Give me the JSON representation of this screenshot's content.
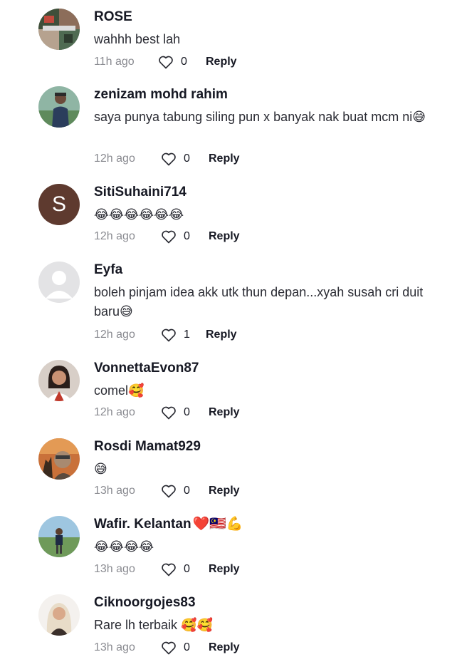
{
  "comments": [
    {
      "username": "ROSE",
      "username_emoji": "",
      "text": "wahhh best lah",
      "time": "11h ago",
      "likes": "0",
      "reply_label": "Reply"
    },
    {
      "username": "zenizam mohd rahim",
      "username_emoji": "",
      "text": "saya punya tabung siling pun x banyak nak buat mcm ni😅",
      "time": "12h ago",
      "likes": "0",
      "reply_label": "Reply"
    },
    {
      "username": "SitiSuhaini714",
      "username_emoji": "",
      "text": "😂😂😂😂😂😂",
      "time": "12h ago",
      "likes": "0",
      "reply_label": "Reply",
      "avatar_letter": "S"
    },
    {
      "username": "Eyfa",
      "username_emoji": "",
      "text": "boleh pinjam idea akk utk thun depan...xyah susah cri duit baru😅",
      "time": "12h ago",
      "likes": "1",
      "reply_label": "Reply"
    },
    {
      "username": "VonnettaEvon87",
      "username_emoji": "",
      "text": "comel🥰",
      "time": "12h ago",
      "likes": "0",
      "reply_label": "Reply"
    },
    {
      "username": "Rosdi Mamat929",
      "username_emoji": "",
      "text": "😅",
      "time": "13h ago",
      "likes": "0",
      "reply_label": "Reply"
    },
    {
      "username": "Wafir. Kelantan",
      "username_emoji": "❤️🇲🇾💪",
      "text": "😂😂😂😂",
      "time": "13h ago",
      "likes": "0",
      "reply_label": "Reply"
    },
    {
      "username": "Ciknoorgojes83",
      "username_emoji": "",
      "text": "Rare lh terbaik 🥰🥰",
      "time": "13h ago",
      "likes": "0",
      "reply_label": "Reply"
    }
  ],
  "icons": {
    "like": "heart-outline-icon"
  },
  "colors": {
    "time": "#8a8b91",
    "avatar_letter_bg": "#5e3a2f",
    "default_avatar_bg": "#e3e3e5"
  }
}
